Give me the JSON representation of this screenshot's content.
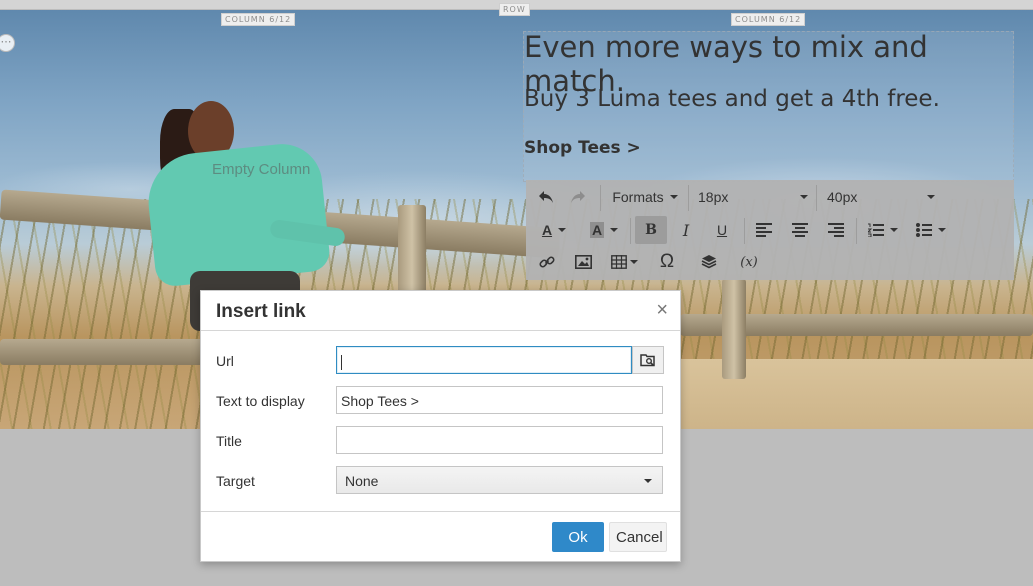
{
  "builder": {
    "row_badge": "ROW",
    "left_column_badge": "COLUMN 6/12",
    "right_column_badge": "COLUMN 6/12",
    "empty_column_label": "Empty Column"
  },
  "content": {
    "heading1": "Even more ways to mix and match.",
    "heading2": "Buy 3 Luma tees and get a 4th free.",
    "link_text": "Shop Tees >"
  },
  "toolbar": {
    "formats_label": "Formats",
    "font_size_value": "18px",
    "line_height_value": "40px",
    "icons": [
      "undo-icon",
      "redo-icon",
      "font-color-icon",
      "background-color-icon",
      "bold-icon",
      "italic-icon",
      "underline-icon",
      "align-left-icon",
      "align-center-icon",
      "align-right-icon",
      "numbered-list-icon",
      "bullet-list-icon",
      "link-icon",
      "image-icon",
      "table-icon",
      "special-character-icon",
      "widget-icon",
      "variable-icon"
    ],
    "variable_label": "(x)"
  },
  "dialog": {
    "title": "Insert link",
    "close_glyph": "×",
    "url_label": "Url",
    "url_value": "",
    "text_label": "Text to display",
    "text_value": "Shop Tees >",
    "title_label": "Title",
    "title_value": "",
    "target_label": "Target",
    "target_value": "None",
    "ok_label": "Ok",
    "cancel_label": "Cancel"
  },
  "colors": {
    "primary_button": "#2f89c9",
    "url_focus_border": "#2f8cc2",
    "page_background": "#bdbdbd"
  }
}
